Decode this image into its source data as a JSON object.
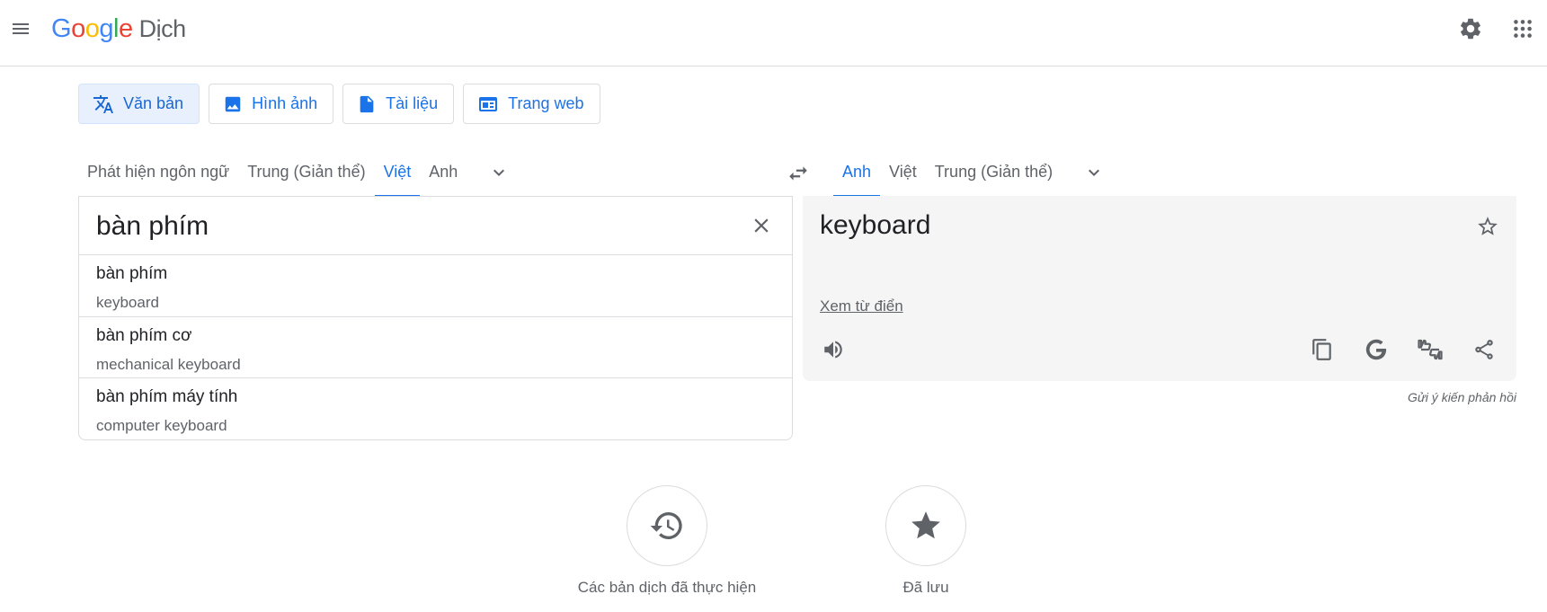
{
  "header": {
    "logo_letters": [
      "G",
      "o",
      "o",
      "g",
      "l",
      "e"
    ],
    "logo_colors": [
      "#4285f4",
      "#ea4335",
      "#fbbc05",
      "#4285f4",
      "#34a853",
      "#ea4335"
    ],
    "product": "Dịch",
    "icons": [
      "menu-icon",
      "gear-icon",
      "apps-grid-icon"
    ]
  },
  "mode_tabs": [
    {
      "label": "Văn bản",
      "icon": "translate-icon",
      "active": true
    },
    {
      "label": "Hình ảnh",
      "icon": "image-icon",
      "active": false
    },
    {
      "label": "Tài liệu",
      "icon": "document-icon",
      "active": false
    },
    {
      "label": "Trang web",
      "icon": "web-icon",
      "active": false
    }
  ],
  "source_langs": [
    "Phát hiện ngôn ngữ",
    "Trung (Giản thể)",
    "Việt",
    "Anh"
  ],
  "source_active_index": 2,
  "target_langs": [
    "Anh",
    "Việt",
    "Trung (Giản thể)"
  ],
  "target_active_index": 0,
  "source": {
    "text": "bàn phím",
    "suggestions": [
      {
        "text": "bàn phím",
        "translation": "keyboard"
      },
      {
        "text": "bàn phím cơ",
        "translation": "mechanical keyboard"
      },
      {
        "text": "bàn phím máy tính",
        "translation": "computer keyboard"
      }
    ]
  },
  "target": {
    "text": "keyboard",
    "dictionary_link": "Xem từ điển",
    "feedback": "Gửi ý kiến phản hồi"
  },
  "bottom": {
    "history_label": "Các bản dịch đã thực hiện",
    "saved_label": "Đã lưu"
  },
  "colors": {
    "accent": "#1a73e8",
    "active_tab_bg": "#e8f0fe",
    "icon_gray": "#5f6368"
  }
}
